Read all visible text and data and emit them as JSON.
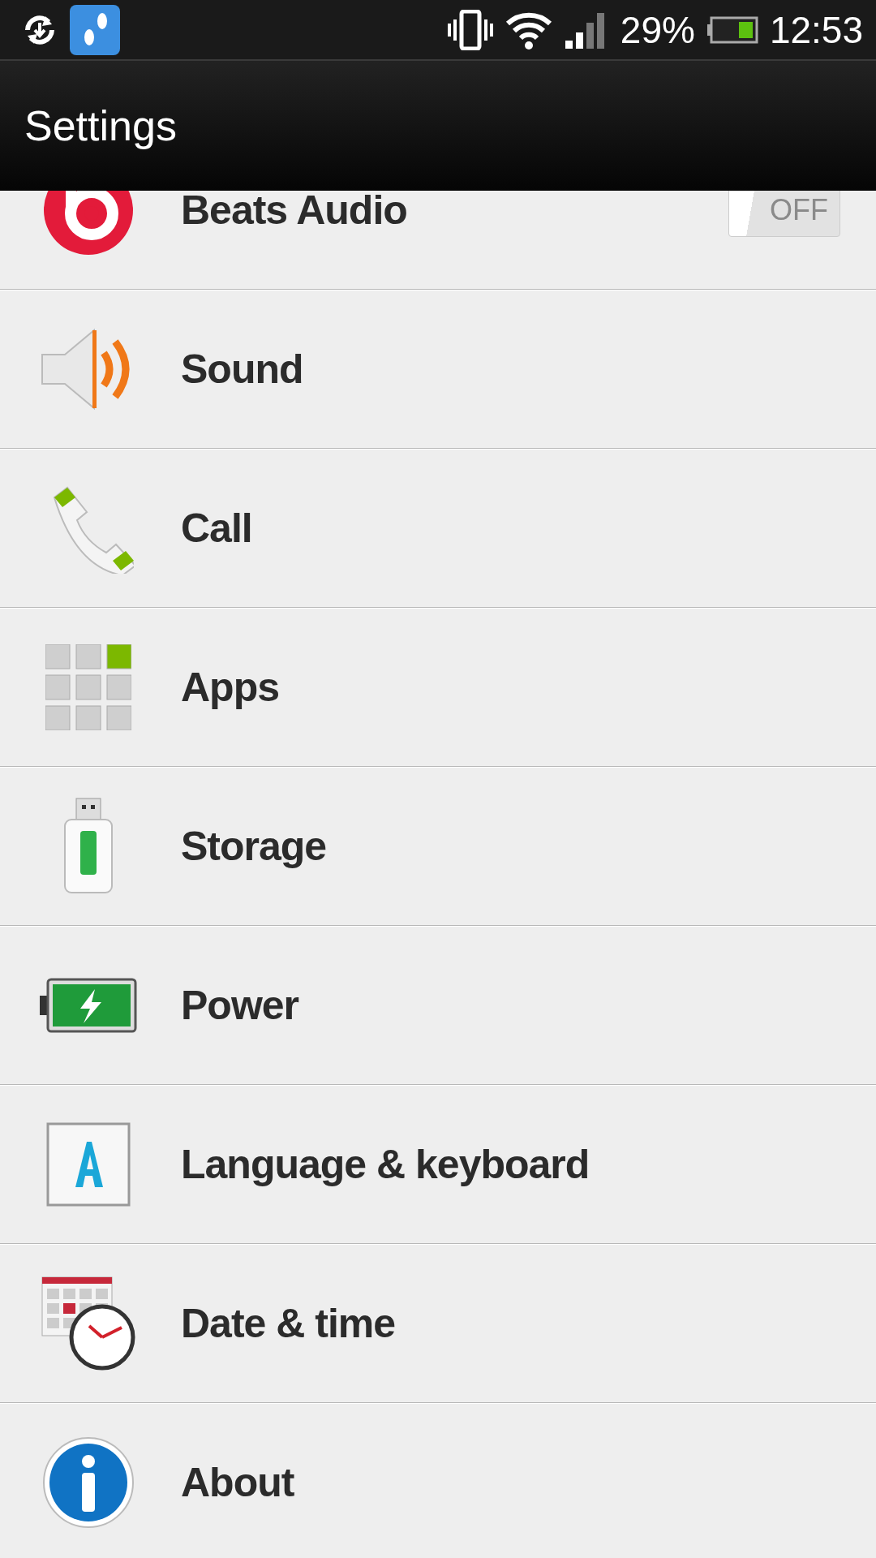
{
  "status_bar": {
    "battery": "29%",
    "time": "12:53"
  },
  "header": {
    "title": "Settings"
  },
  "items": [
    {
      "label": "Beats Audio",
      "kind": "toggle",
      "on": false,
      "toggle_label": "OFF"
    },
    {
      "label": "Sound",
      "kind": "link"
    },
    {
      "label": "Call",
      "kind": "link"
    },
    {
      "label": "Apps",
      "kind": "link"
    },
    {
      "label": "Storage",
      "kind": "link"
    },
    {
      "label": "Power",
      "kind": "link"
    },
    {
      "label": "Language & keyboard",
      "kind": "link"
    },
    {
      "label": "Date & time",
      "kind": "link"
    },
    {
      "label": "About",
      "kind": "link"
    }
  ]
}
